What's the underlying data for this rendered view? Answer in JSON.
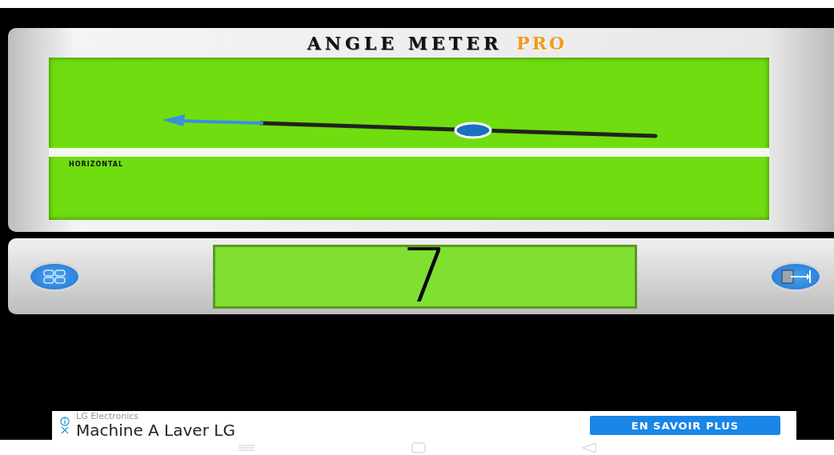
{
  "header": {
    "title": "ANGLE METER",
    "badge": "PRO"
  },
  "gauge": {
    "reference_label": "HORIZONTAL"
  },
  "readout": {
    "value": "7"
  },
  "ad": {
    "advertiser": "LG Electronics",
    "headline": "Machine A Laver LG",
    "button": "EN SAVOIR PLUS"
  }
}
